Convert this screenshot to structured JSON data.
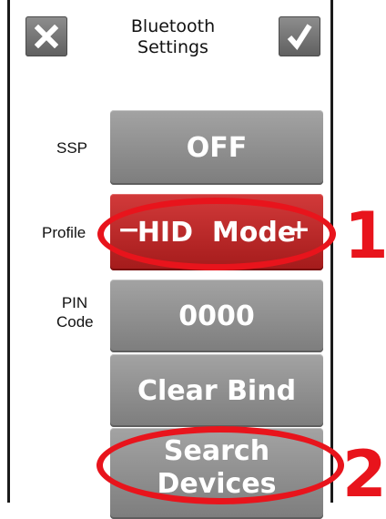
{
  "header": {
    "title_line1": "Bluetooth",
    "title_line2": "Settings",
    "close_icon": "close-icon",
    "confirm_icon": "checkmark-icon"
  },
  "settings": {
    "ssp": {
      "label": "SSP",
      "value": "OFF"
    },
    "profile": {
      "label": "Profile",
      "value": "HID  Mode",
      "decrement": "−",
      "increment": "+"
    },
    "pin": {
      "label_line1": "PIN",
      "label_line2": "Code",
      "value": "0000"
    },
    "clear_bind": {
      "label": "Clear Bind"
    },
    "search_devices": {
      "label_line1": "Search",
      "label_line2": "Devices"
    }
  },
  "annotations": {
    "marker_1": "1",
    "marker_2": "2",
    "color": "#e8141c"
  }
}
